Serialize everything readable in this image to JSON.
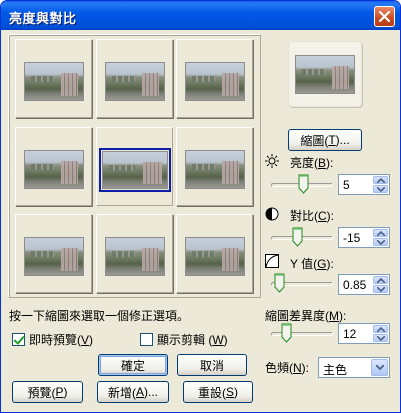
{
  "window": {
    "title": "亮度與對比"
  },
  "grid": {
    "cell_count": 9,
    "selected_index": 4
  },
  "hint_text": "按一下縮圖來選取一個修正選項。",
  "checkboxes": {
    "live_preview": {
      "label": "即時預覽(",
      "accel": "V",
      "close": ")",
      "checked": true
    },
    "show_clipping": {
      "label": "顯示剪輯 (",
      "accel": "W",
      "close": ")",
      "checked": false
    }
  },
  "buttons": {
    "ok": "確定",
    "cancel": "取消",
    "preview": {
      "label": "預覽(",
      "accel": "P",
      "close": ")"
    },
    "new": {
      "label": "新增(",
      "accel": "A",
      "close": ")..."
    },
    "reset": {
      "label": "重設(",
      "accel": "S",
      "close": ")"
    },
    "thumbnail": {
      "label": "縮圖(",
      "accel": "T",
      "close": ")..."
    }
  },
  "controls": {
    "brightness": {
      "label": "亮度(",
      "accel": "B",
      "close": "):",
      "value": "5",
      "level": 0.52
    },
    "contrast": {
      "label": "對比(",
      "accel": "C",
      "close": "):",
      "value": "-15",
      "level": 0.42
    },
    "gamma": {
      "label": "Υ 值(",
      "accel": "G",
      "close": "):",
      "value": "0.85",
      "level": 0.05
    },
    "thumb_diff": {
      "label": "縮圖差異度(",
      "accel": "M",
      "close": "):",
      "value": "12",
      "level": 0.2
    }
  },
  "color_channel": {
    "label": "色頻(",
    "accel": "N",
    "close": "):",
    "selected": "主色"
  },
  "colors": {
    "title_bar": "#0058e6",
    "dialog_bg": "#ece9d8",
    "selected_frame": "#0e1ea8",
    "close_button": "#c94b22"
  }
}
